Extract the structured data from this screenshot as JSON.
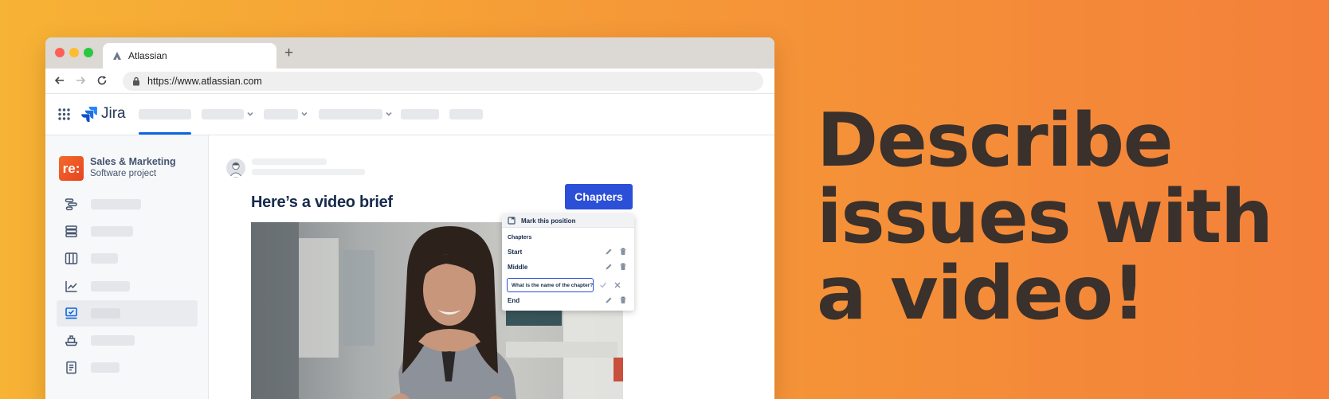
{
  "browser": {
    "tab_title": "Atlassian",
    "new_tab_symbol": "+",
    "url": "https://www.atlassian.com"
  },
  "jira": {
    "logo_text": "Jira",
    "brand_color": "#0c66e4"
  },
  "sidebar": {
    "project_logo": "re:",
    "project_name": "Sales & Marketing",
    "project_type": "Software project",
    "items": [
      {
        "icon": "roadmap-icon"
      },
      {
        "icon": "backlog-icon"
      },
      {
        "icon": "board-icon"
      },
      {
        "icon": "reports-icon"
      },
      {
        "icon": "video-brief-icon",
        "active": true
      },
      {
        "icon": "releases-icon"
      },
      {
        "icon": "pages-icon"
      }
    ]
  },
  "content": {
    "title": "Here’s a video brief",
    "chapters_button": "Chapters",
    "accent_color": "#2c4fd8"
  },
  "chapters_panel": {
    "header": "Mark this position",
    "subheader": "Chapters",
    "chapters": [
      "Start",
      "Middle"
    ],
    "input_value": "What is the name of the chapter?",
    "last_chapter": "End"
  },
  "headline": {
    "line1": "Describe",
    "line2": "issues with",
    "line3": "a video!",
    "color": "#3a302c"
  }
}
